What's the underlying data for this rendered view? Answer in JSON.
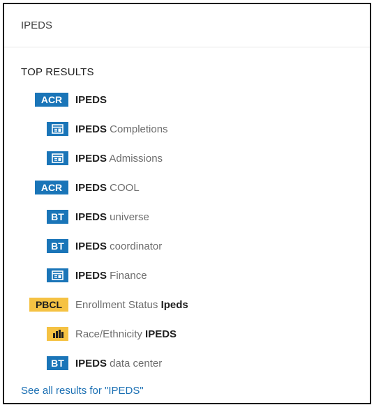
{
  "search": {
    "value": "IPEDS",
    "placeholder": ""
  },
  "section_title": "TOP RESULTS",
  "results": [
    {
      "badge": "ACR",
      "type": "acr",
      "prefix": "",
      "highlight": "IPEDS",
      "suffix": ""
    },
    {
      "badge": "",
      "type": "report",
      "prefix": "",
      "highlight": "IPEDS",
      "suffix": " Completions"
    },
    {
      "badge": "",
      "type": "report",
      "prefix": "",
      "highlight": "IPEDS",
      "suffix": " Admissions"
    },
    {
      "badge": "ACR",
      "type": "acr",
      "prefix": "",
      "highlight": "IPEDS",
      "suffix": " COOL"
    },
    {
      "badge": "BT",
      "type": "bt",
      "prefix": "",
      "highlight": "IPEDS",
      "suffix": " universe"
    },
    {
      "badge": "BT",
      "type": "bt",
      "prefix": "",
      "highlight": "IPEDS",
      "suffix": " coordinator"
    },
    {
      "badge": "",
      "type": "report",
      "prefix": "",
      "highlight": "IPEDS",
      "suffix": " Finance"
    },
    {
      "badge": "PBCL",
      "type": "pbcl",
      "prefix": "Enrollment Status ",
      "highlight": "Ipeds",
      "suffix": ""
    },
    {
      "badge": "",
      "type": "chart",
      "prefix": "Race/Ethnicity ",
      "highlight": "IPEDS",
      "suffix": ""
    },
    {
      "badge": "BT",
      "type": "bt",
      "prefix": "",
      "highlight": "IPEDS",
      "suffix": " data center"
    }
  ],
  "see_all": "See all results for \"IPEDS\"",
  "colors": {
    "blue": "#1a75b8",
    "yellow": "#f5c243",
    "link": "#1a6fb3"
  },
  "icons": {
    "report": "report-card-icon",
    "chart": "bar-chart-icon"
  }
}
